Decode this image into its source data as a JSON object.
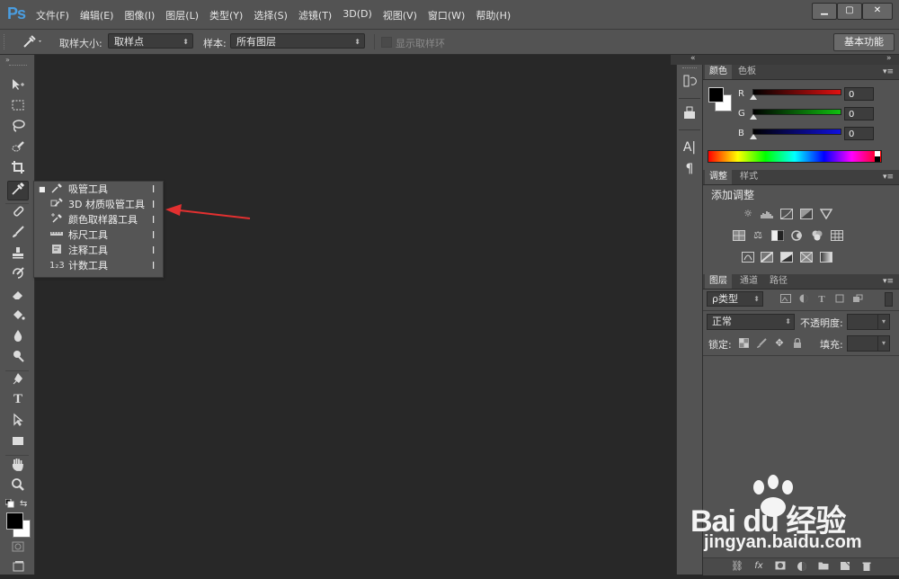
{
  "app": {
    "logo": "Ps"
  },
  "menu": [
    "文件(F)",
    "编辑(E)",
    "图像(I)",
    "图层(L)",
    "类型(Y)",
    "选择(S)",
    "滤镜(T)",
    "3D(D)",
    "视图(V)",
    "窗口(W)",
    "帮助(H)"
  ],
  "window_controls": {
    "minimize": "▁",
    "restore": "▢",
    "close": "✕"
  },
  "options_bar": {
    "sample_size_label": "取样大小:",
    "sample_size_value": "取样点",
    "sample_label": "样本:",
    "sample_value": "所有图层",
    "show_ring_label": "显示取样环",
    "workspace_label": "基本功能"
  },
  "flyout": {
    "items": [
      {
        "icon": "eyedropper-icon",
        "label": "吸管工具",
        "key": "I",
        "selected": true
      },
      {
        "icon": "3d-material-eyedropper-icon",
        "label": "3D 材质吸管工具",
        "key": "I",
        "selected": false
      },
      {
        "icon": "color-sampler-icon",
        "label": "颜色取样器工具",
        "key": "I",
        "selected": false
      },
      {
        "icon": "ruler-icon",
        "label": "标尺工具",
        "key": "I",
        "selected": false
      },
      {
        "icon": "note-icon",
        "label": "注释工具",
        "key": "I",
        "selected": false
      },
      {
        "icon": "count-icon",
        "label": "计数工具",
        "key": "I",
        "selected": false
      }
    ],
    "count_icon_glyph": "1₂3"
  },
  "color_panel": {
    "tabs": [
      "颜色",
      "色板"
    ],
    "channels": [
      {
        "name": "R",
        "value": "0",
        "color": "#e01010"
      },
      {
        "name": "G",
        "value": "0",
        "color": "#10c010"
      },
      {
        "name": "B",
        "value": "0",
        "color": "#1010e0"
      }
    ]
  },
  "adjustments_panel": {
    "tabs": [
      "调整",
      "样式"
    ],
    "title": "添加调整"
  },
  "layers_panel": {
    "tabs": [
      "图层",
      "通道",
      "路径"
    ],
    "filter_value": "ρ类型",
    "blend_mode": "正常",
    "opacity_label": "不透明度:",
    "lock_label": "锁定:",
    "fill_label": "填充:",
    "footer_icons": [
      "link-icon",
      "fx-icon",
      "mask-icon",
      "adjustment-icon",
      "folder-icon",
      "new-layer-icon",
      "trash-icon"
    ],
    "fx_label": "fx"
  },
  "strip_glyphs": {
    "character": "A|",
    "paragraph": "¶"
  },
  "watermark": {
    "brand": "Bai du 经验",
    "url": "jingyan.baidu.com"
  },
  "colors": {
    "ui": "#535353",
    "canvas": "#282828",
    "accent_logo": "#4a9de0",
    "arrow": "#e23030"
  }
}
